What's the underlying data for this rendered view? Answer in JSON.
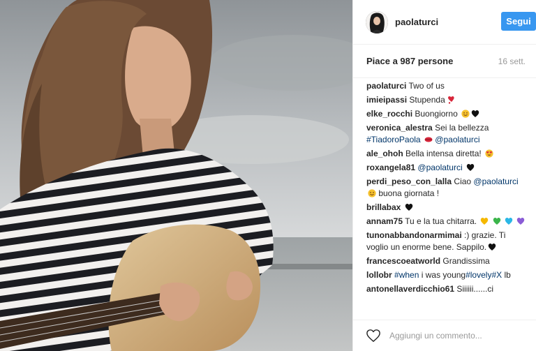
{
  "post": {
    "username": "paolaturci",
    "follow_label": "Segui",
    "likes": "Piace a 987 persone",
    "date": "16 sett."
  },
  "comments": [
    {
      "user": "paolaturci",
      "parts": [
        {
          "text": " Two of us"
        }
      ]
    },
    {
      "user": "imieipassi",
      "parts": [
        {
          "text": " Stupenda"
        },
        {
          "emoji": "heart-exclamation-icon"
        }
      ]
    },
    {
      "user": "elke_rocchi",
      "parts": [
        {
          "text": " Buongiorno "
        },
        {
          "emoji": "smiling-face-icon"
        },
        {
          "emoji": "black-heart-icon"
        }
      ]
    },
    {
      "user": "veronica_alestra",
      "parts": [
        {
          "text": " Sei la bellezza "
        },
        {
          "mention": "#TiadoroPaola"
        },
        {
          "text": " "
        },
        {
          "emoji": "kiss-mark-icon"
        },
        {
          "text": " "
        },
        {
          "mention": "@paolaturci"
        }
      ]
    },
    {
      "user": "ale_ohoh",
      "parts": [
        {
          "text": " Bella intensa diretta! "
        },
        {
          "emoji": "heart-eyes-icon"
        }
      ]
    },
    {
      "user": "roxangela81",
      "parts": [
        {
          "text": " "
        },
        {
          "mention": "@paolaturci"
        },
        {
          "text": " "
        },
        {
          "emoji": "black-heart-icon"
        }
      ]
    },
    {
      "user": "perdi_peso_con_lalla",
      "parts": [
        {
          "text": " Ciao "
        },
        {
          "mention": "@paolaturci"
        },
        {
          "text": " "
        },
        {
          "emoji": "smiling-face-icon"
        },
        {
          "text": " buona giornata !"
        }
      ]
    },
    {
      "user": "brillabax",
      "parts": [
        {
          "text": " "
        },
        {
          "emoji": "black-heart-icon"
        }
      ]
    },
    {
      "user": "annam75",
      "parts": [
        {
          "text": " Tu e la tua chitarra. "
        },
        {
          "emoji": "yellow-heart-icon"
        },
        {
          "text": " "
        },
        {
          "emoji": "green-heart-icon"
        },
        {
          "text": " "
        },
        {
          "emoji": "blue-heart-icon"
        },
        {
          "text": " "
        },
        {
          "emoji": "purple-heart-icon"
        }
      ]
    },
    {
      "user": "tunonabbandonarmimai",
      "parts": [
        {
          "text": " :) grazie. Ti voglio un enorme bene. Sappilo."
        },
        {
          "emoji": "black-heart-icon"
        }
      ]
    },
    {
      "user": "francescoeatworld",
      "parts": [
        {
          "text": " Grandissima"
        }
      ]
    },
    {
      "user": "lollobr",
      "parts": [
        {
          "text": " "
        },
        {
          "mention": "#when"
        },
        {
          "text": " i was young"
        },
        {
          "mention": "#lovely"
        },
        {
          "mention": "#X"
        },
        {
          "text": " lb"
        }
      ]
    },
    {
      "user": "antonellaverdicchio61",
      "parts": [
        {
          "text": " Siiiiii......ci"
        }
      ]
    }
  ],
  "footer": {
    "comment_placeholder": "Aggiungi un commento..."
  },
  "colors": {
    "accent": "#3897f0",
    "mention": "#003569",
    "muted": "#999999"
  },
  "emoji_colors": {
    "heart-exclamation-icon": "#d8263a",
    "black-heart-icon": "#111111",
    "smiling-face-icon": "#f5c12e",
    "kiss-mark-icon": "#d8263a",
    "heart-eyes-icon": "#f5c12e",
    "yellow-heart-icon": "#f5b800",
    "green-heart-icon": "#3bb54a",
    "blue-heart-icon": "#2ab7e6",
    "purple-heart-icon": "#8a5cd6"
  }
}
